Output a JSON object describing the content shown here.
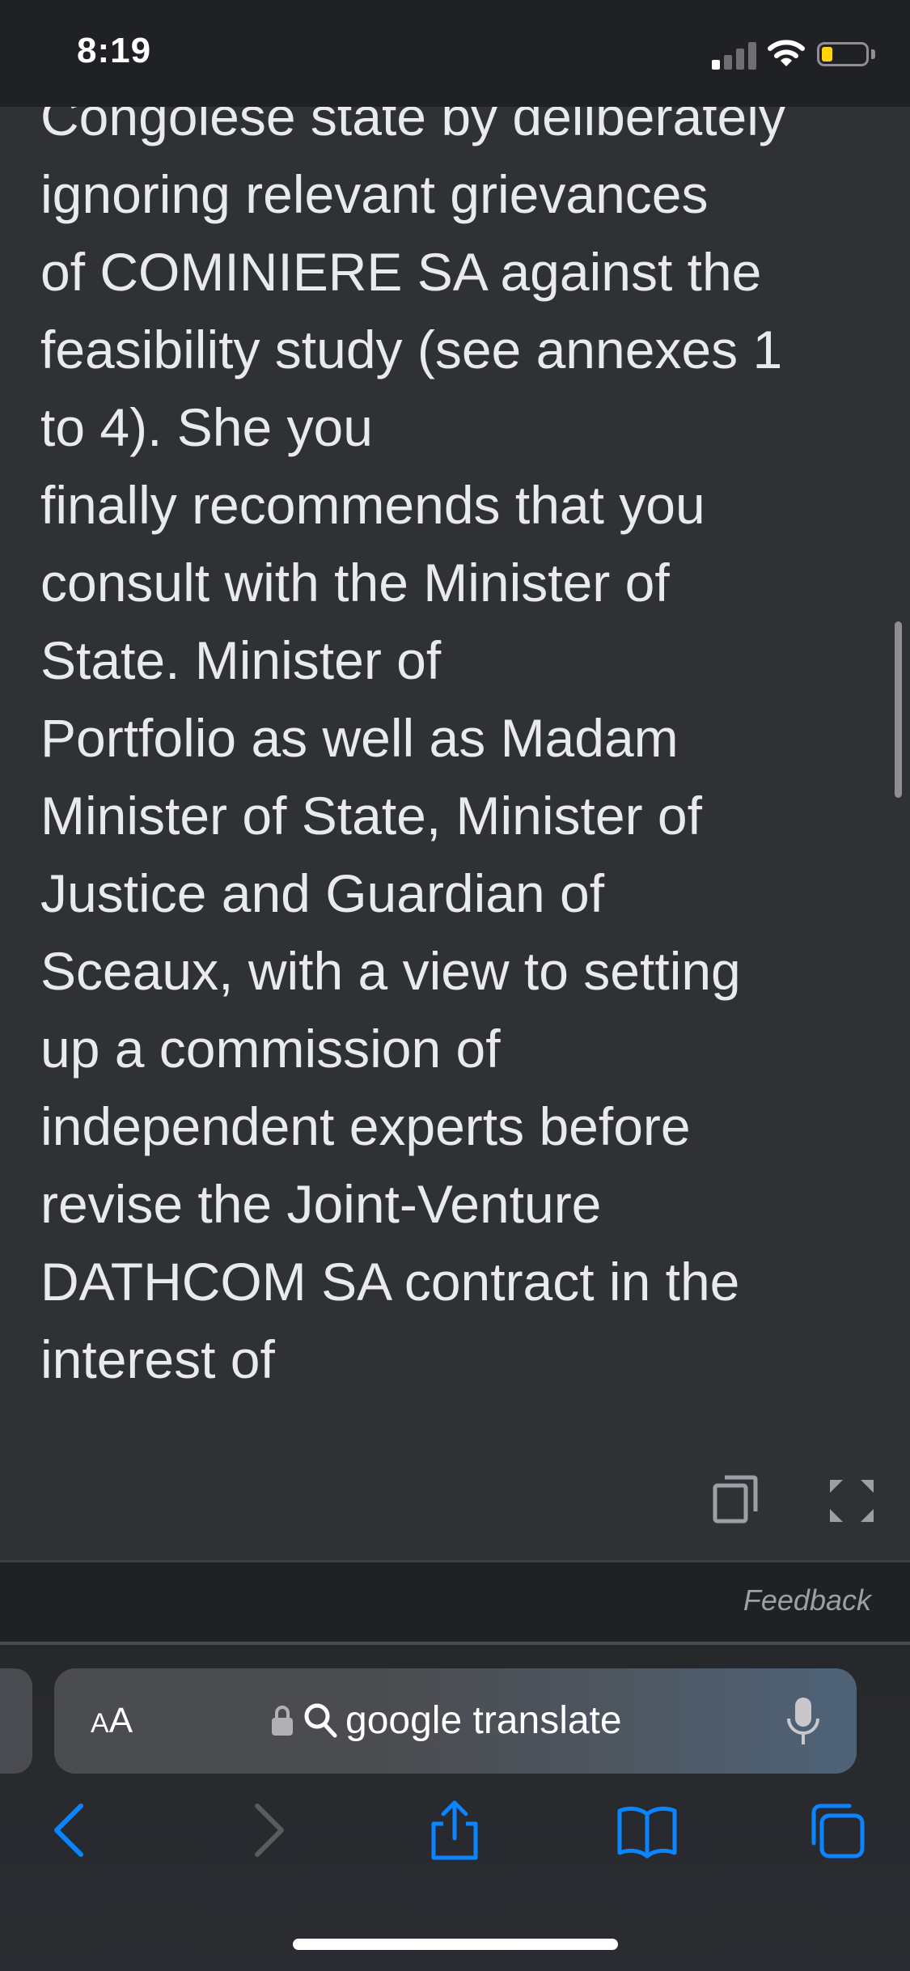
{
  "status_bar": {
    "time": "8:19",
    "battery_level": 0.25,
    "signal_bars_active": 1
  },
  "translation": {
    "text": "Congolese state by deliberately\nignoring relevant grievances\nof COMINIERE SA against the\nfeasibility study (see annexes 1\nto 4). She you\nfinally recommends that you\nconsult with the Minister of\nState. Minister of\nPortfolio as well as Madam\nMinister of State, Minister of\nJustice and Guardian of\nSceaux, with a view to setting\nup a commission of\nindependent experts before\nrevise the Joint-Venture\nDATHCOM SA contract in the\ninterest of"
  },
  "card_actions": {
    "copy_icon": "copy-icon",
    "fullscreen_icon": "fullscreen-icon"
  },
  "feedback": {
    "label": "Feedback"
  },
  "address_bar": {
    "aa_small": "A",
    "aa_big": "A",
    "url_text": "google translate"
  },
  "toolbar": {
    "icons": [
      "back-icon",
      "forward-icon",
      "share-icon",
      "bookmarks-icon",
      "tabs-icon"
    ]
  },
  "colors": {
    "background": "#303134",
    "text": "#e8eaed",
    "accent": "#0a84ff",
    "battery": "#ffd60a"
  }
}
